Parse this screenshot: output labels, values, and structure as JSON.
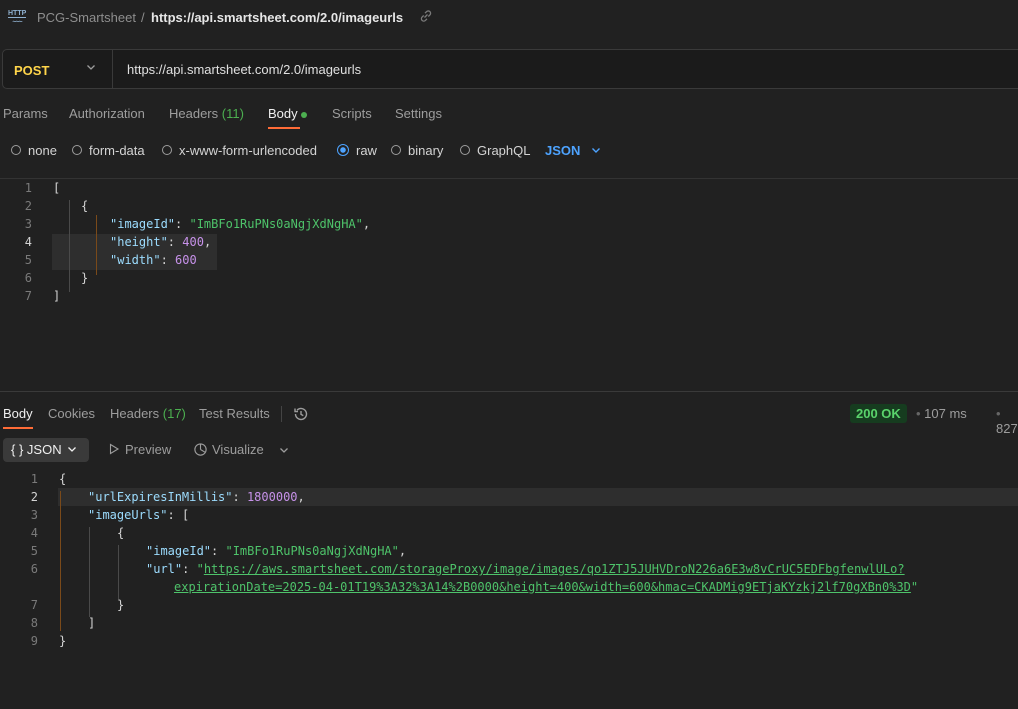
{
  "breadcrumb": {
    "icon_label": "HTTP",
    "collection": "PCG-Smartsheet",
    "separator": "/",
    "request_name": "https://api.smartsheet.com/2.0/imageurls"
  },
  "request": {
    "method": "POST",
    "url": "https://api.smartsheet.com/2.0/imageurls"
  },
  "request_tabs": {
    "params": "Params",
    "authorization": "Authorization",
    "headers": "Headers",
    "headers_count": "(11)",
    "body": "Body",
    "scripts": "Scripts",
    "settings": "Settings"
  },
  "body_types": {
    "none": "none",
    "form_data": "form-data",
    "urlencoded": "x-www-form-urlencoded",
    "raw": "raw",
    "binary": "binary",
    "graphql": "GraphQL",
    "format": "JSON"
  },
  "request_body": {
    "line_numbers": [
      "1",
      "2",
      "3",
      "4",
      "5",
      "6",
      "7"
    ],
    "open_bracket": "[",
    "open_brace": "{",
    "k_imageId": "\"imageId\"",
    "v_imageId": "\"ImBFo1RuPNs0aNgjXdNgHA\"",
    "k_height": "\"height\"",
    "v_height": "400",
    "k_width": "\"width\"",
    "v_width": "600",
    "close_brace": "}",
    "close_bracket": "]",
    "colon": ": ",
    "comma": ","
  },
  "response_tabs": {
    "body": "Body",
    "cookies": "Cookies",
    "headers": "Headers",
    "headers_count": "(17)",
    "test_results": "Test Results"
  },
  "response_status": {
    "status": "200 OK",
    "time": "107 ms",
    "size": "827"
  },
  "response_toolbar": {
    "format": "JSON",
    "format_icon": "{ }",
    "preview": "Preview",
    "visualize": "Visualize"
  },
  "response_body": {
    "line_numbers": [
      "1",
      "2",
      "3",
      "4",
      "5",
      "6",
      "",
      "7",
      "8",
      "9"
    ],
    "open_brace": "{",
    "k_urlExpires": "\"urlExpiresInMillis\"",
    "v_urlExpires": "1800000",
    "k_imageUrls": "\"imageUrls\"",
    "open_bracket": "[",
    "inner_open": "{",
    "k_imageId": "\"imageId\"",
    "v_imageId": "\"ImBFo1RuPNs0aNgjXdNgHA\"",
    "k_url": "\"url\"",
    "url_quote_open": "\"",
    "url_part1": "https://aws.smartsheet.com/storageProxy/image/images/qo1ZTJ5JUHVDroN226a6E3w8vCrUC5EDFbgfenwlULo?",
    "url_part2": "expirationDate=2025-04-01T19%3A32%3A14%2B0000&height=400&width=600&hmac=CKADMig9ETjaKYzkj2lf70gXBn0%3D",
    "url_quote_close": "\"",
    "inner_close": "}",
    "close_bracket": "]",
    "close_brace": "}",
    "colon": ": ",
    "comma": ","
  },
  "colors": {
    "accent": "#ff6c37",
    "method_post": "#ffd54a",
    "json_key": "#9cdcfe",
    "json_string": "#4ec36a",
    "json_number": "#c792ea",
    "status_ok": "#5ad36b",
    "selected_blue": "#4da3ff"
  },
  "icons": {
    "http": "http-file-icon",
    "link": "link-icon",
    "method_dropdown": "chevron-down-icon",
    "format_dropdown": "chevron-down-icon",
    "history": "history-icon",
    "preview": "play-icon",
    "visualize": "visualize-icon"
  }
}
